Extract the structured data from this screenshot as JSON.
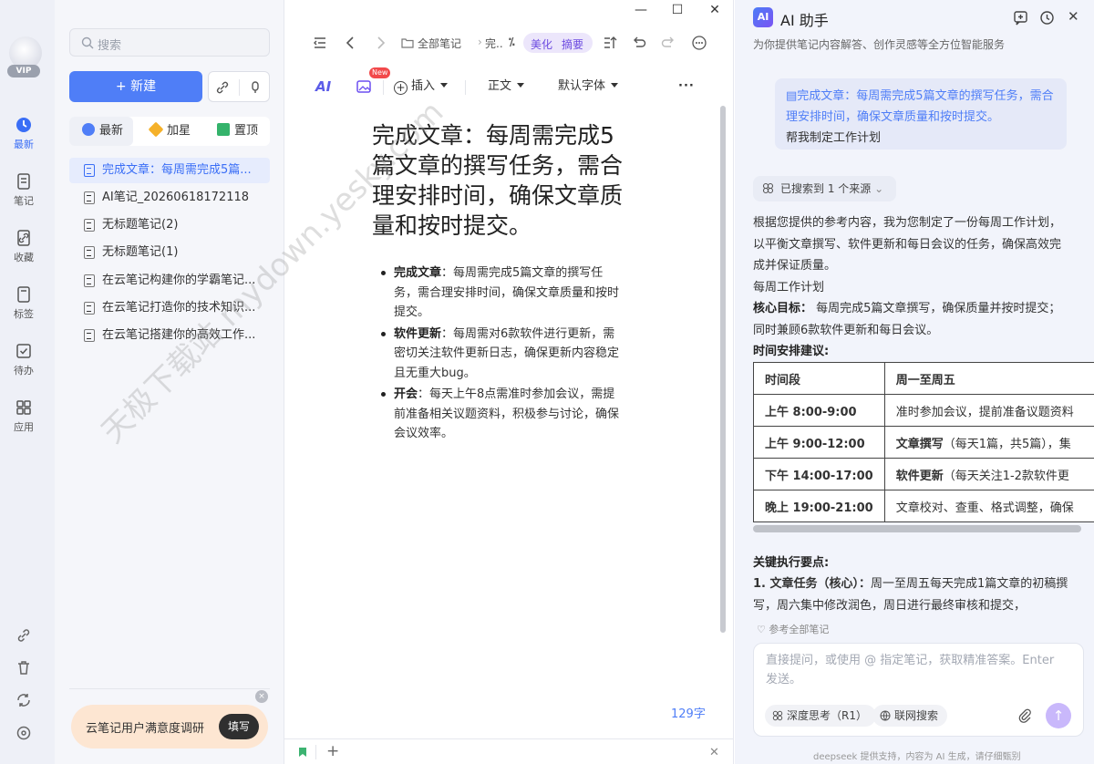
{
  "window": {
    "minimize": "—",
    "maximize": "☐",
    "close": "✕"
  },
  "rail": {
    "vip_badge": "VIP",
    "items": [
      {
        "label": "最新",
        "icon": "clock-icon"
      },
      {
        "label": "笔记",
        "icon": "note-icon"
      },
      {
        "label": "收藏",
        "icon": "link-icon"
      },
      {
        "label": "标签",
        "icon": "bookmark-icon"
      },
      {
        "label": "待办",
        "icon": "checkbox-icon"
      },
      {
        "label": "应用",
        "icon": "apps-icon"
      }
    ],
    "bottom_icons": [
      "link-icon",
      "trash-icon",
      "sync-icon",
      "settings-icon"
    ]
  },
  "list": {
    "search_placeholder": "搜索",
    "new_button": "+ 新建",
    "tabs": [
      {
        "label": "最新",
        "icon_color": "#4f7ef7"
      },
      {
        "label": "加星",
        "icon_color": "#f5b12a"
      },
      {
        "label": "置顶",
        "icon_color": "#34b36b"
      }
    ],
    "notes": [
      "完成文章：每周需完成5篇...",
      "AI笔记_20260618172118",
      "无标题笔记(2)",
      "无标题笔记(1)",
      "在云笔记构建你的学霸笔记...",
      "在云笔记打造你的技术知识...",
      "在云笔记搭建你的高效工作..."
    ],
    "survey_text": "云笔记用户满意度调研",
    "survey_button": "填写",
    "survey_close": "×"
  },
  "editor": {
    "breadcrumb": "全部笔记",
    "breadcrumb_current": "完..",
    "beautify": "美化",
    "summary": "摘要",
    "toolbar": {
      "ai": "AI",
      "new_badge": "New",
      "insert": "插入",
      "style": "正文",
      "font": "默认字体",
      "more": "···"
    },
    "title": "完成文章：每周需完成5篇文章的撰写任务，需合理安排时间，确保文章质量和按时提交。",
    "bullets": [
      {
        "head": "完成文章",
        "text": "：每周需完成5篇文章的撰写任务，需合理安排时间，确保文章质量和按时提交。"
      },
      {
        "head": "软件更新",
        "text": "：每周需对6款软件进行更新，需密切关注软件更新日志，确保更新内容稳定且无重大bug。"
      },
      {
        "head": "开会",
        "text": "：每天上午8点需准时参加会议，需提前准备相关议题资料，积极参与讨论，确保会议效率。"
      }
    ],
    "word_count": "129字",
    "footer_add": "+",
    "footer_close": "✕"
  },
  "ai_panel": {
    "logo": "AI",
    "title": "AI 助手",
    "subtitle": "为你提供笔记内容解答、创作灵感等全方位智能服务",
    "user_quote": "完成文章：每周需完成5篇文章的撰写任务，需合理安排时间，确保文章质量和按时提交。",
    "user_ask": "帮我制定工作计划",
    "source_tag": "已搜索到 1 个来源",
    "answer_intro": "根据您提供的参考内容，我为您制定了一份每周工作计划，以平衡文章撰写、软件更新和每日会议的任务，确保高效完成并保证质量。",
    "plan_title": "每周工作计划",
    "core_label": "核心目标：",
    "core_text": "每周完成5篇文章撰写，确保质量并按时提交；同时兼顾6款软件更新和每日会议。",
    "schedule_label": "时间安排建议:",
    "table": {
      "headers": [
        "时间段",
        "周一至周五"
      ],
      "rows": [
        {
          "time": "上午 8:00-9:00",
          "bold": "",
          "text": "准时参加会议，提前准备议题资料"
        },
        {
          "time": "上午 9:00-12:00",
          "bold": "文章撰写",
          "text": "（每天1篇，共5篇），集"
        },
        {
          "time": "下午 14:00-17:00",
          "bold": "软件更新",
          "text": "（每天关注1-2款软件更"
        },
        {
          "time": "晚上 19:00-21:00",
          "bold": "",
          "text": "文章校对、查重、格式调整，确保"
        }
      ]
    },
    "key_points_label": "关键执行要点:",
    "key_point_1_head": "1. 文章任务（核心）：",
    "key_point_1_text": "周一至周五每天完成1篇文章的初稿撰写，周六集中修改润色，周日进行最终审核和提交，",
    "ref_all": "参考全部笔记",
    "input_placeholder": "直接提问，或使用 @ 指定笔记，获取精准答案。Enter 发送。",
    "chip_think": "深度思考（R1）",
    "chip_web": "联网搜索",
    "send": "↑",
    "footer": "deepseek 提供支持，内容为 AI 生成，请仔细甄别"
  },
  "watermark": "天极下载站 mydown.yesky.com"
}
